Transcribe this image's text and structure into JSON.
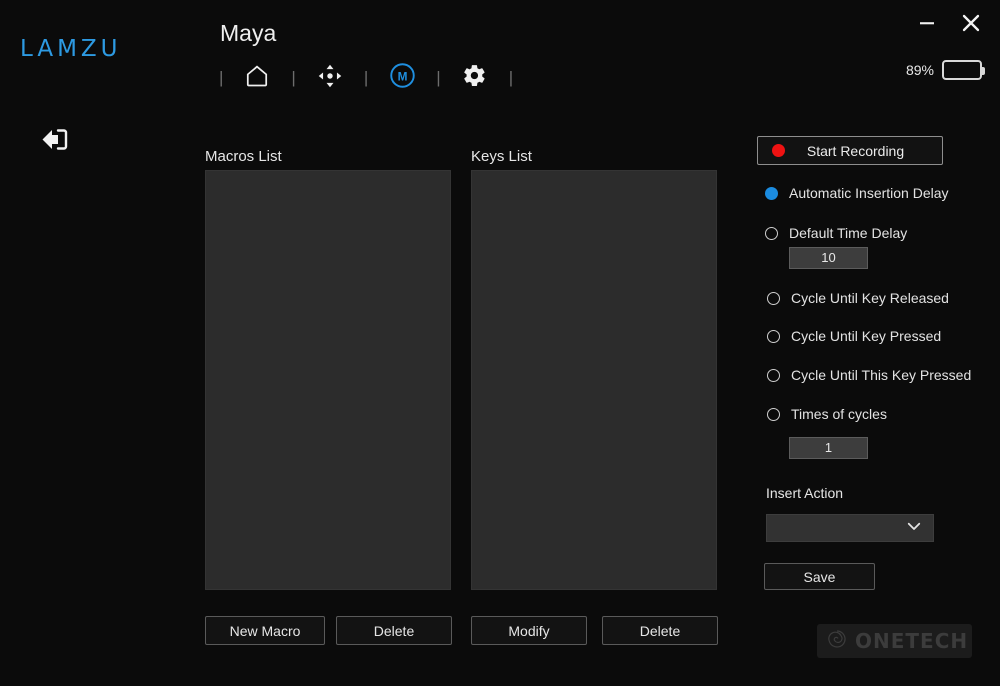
{
  "window": {
    "logo": "LAMZU",
    "title": "Maya",
    "minimize_icon": "minimize-icon",
    "close_icon": "close-icon"
  },
  "battery": {
    "percent_label": "89%",
    "level": 89,
    "icon": "battery-icon"
  },
  "nav": {
    "separator": "|",
    "items": [
      {
        "name": "home",
        "icon": "home-icon",
        "active": false
      },
      {
        "name": "performance",
        "icon": "dpi-crosshair-icon",
        "active": false
      },
      {
        "name": "macro",
        "icon": "macro-m-icon",
        "active": true
      },
      {
        "name": "settings",
        "icon": "gear-icon",
        "active": false
      }
    ]
  },
  "back": {
    "icon": "back-arrow-icon"
  },
  "macros_panel": {
    "label": "Macros List",
    "items": [],
    "buttons": [
      {
        "name": "new-macro",
        "label": "New Macro"
      },
      {
        "name": "delete-macro",
        "label": "Delete"
      }
    ]
  },
  "keys_panel": {
    "label": "Keys List",
    "items": [],
    "buttons": [
      {
        "name": "modify-key",
        "label": "Modify"
      },
      {
        "name": "delete-key",
        "label": "Delete"
      }
    ]
  },
  "recording": {
    "button_label": "Start Recording",
    "dot_color": "#ee1212"
  },
  "options": [
    {
      "label": "Automatic Insertion Delay",
      "selected": true
    },
    {
      "label": "Default Time Delay",
      "selected": false
    },
    {
      "label": "Cycle Until Key Released",
      "selected": false
    },
    {
      "label": "Cycle Until Key Pressed",
      "selected": false
    },
    {
      "label": "Cycle Until This Key Pressed",
      "selected": false
    },
    {
      "label": "Times of cycles",
      "selected": false
    }
  ],
  "fields": {
    "default_time_delay": "10",
    "times_of_cycles": "1"
  },
  "insert_action": {
    "label": "Insert Action",
    "value": "",
    "chevron_icon": "chevron-down-icon"
  },
  "save": {
    "label": "Save"
  },
  "watermark": {
    "text": "ONETECH",
    "icon": "spiral-logo-icon"
  },
  "colors": {
    "accent_blue": "#2d9ae2",
    "radio_selected": "#1b8ce0",
    "record_red": "#ee1212",
    "background": "#0b0b0b",
    "listbox": "#2c2c2c"
  }
}
